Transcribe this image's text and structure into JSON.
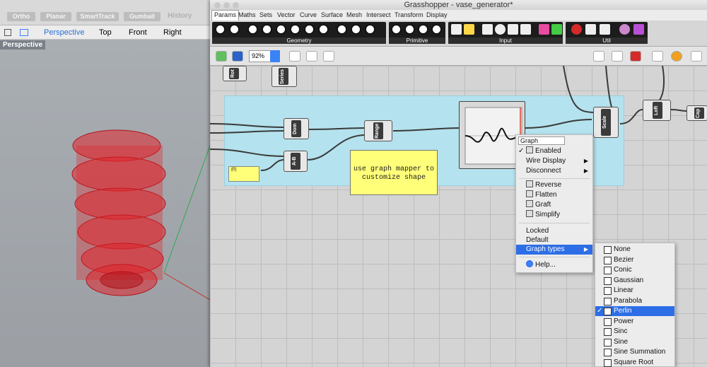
{
  "rhino": {
    "top_buttons": [
      "Ortho",
      "Planar",
      "SmartTrack",
      "Gumball"
    ],
    "history": "History",
    "view_tabs": [
      "Perspective",
      "Top",
      "Front",
      "Right"
    ],
    "viewport_label": "Perspective"
  },
  "gh": {
    "title": "Grasshopper - vase_generator*",
    "menu": [
      "Params",
      "Maths",
      "Sets",
      "Vector",
      "Curve",
      "Surface",
      "Mesh",
      "Intersect",
      "Transform",
      "Display"
    ],
    "ribbon_groups": [
      "Geometry",
      "Primitive",
      "Input",
      "Util"
    ],
    "zoom": "92%"
  },
  "canvas": {
    "note": "use graph mapper to customize shape",
    "panel": "{0}",
    "components": {
      "dom": "Dom",
      "range": "Range",
      "ab": "A-B",
      "scale": "Scale",
      "loft": "Loft",
      "series": "Series",
      "rot": "Rot",
      "cap": "Cap"
    },
    "graph_label": "Graph"
  },
  "context_menu": {
    "header": "Graph",
    "items": [
      {
        "label": "Enabled",
        "checked": "✓"
      },
      {
        "label": "Wire Display",
        "arrow": "▶"
      },
      {
        "label": "Disconnect",
        "arrow": "▶"
      },
      {
        "label": "Reverse"
      },
      {
        "label": "Flatten"
      },
      {
        "label": "Graft"
      },
      {
        "label": "Simplify"
      },
      {
        "label": "Locked"
      },
      {
        "label": "Default"
      },
      {
        "label": "Graph types",
        "arrow": "▶"
      },
      {
        "label": "Help..."
      }
    ]
  },
  "graph_types": {
    "items": [
      "None",
      "Bezier",
      "Conic",
      "Gaussian",
      "Linear",
      "Parabola",
      "Perlin",
      "Power",
      "Sinc",
      "Sine",
      "Sine Summation",
      "Square Root"
    ],
    "selected": "Perlin",
    "check": "✓"
  }
}
